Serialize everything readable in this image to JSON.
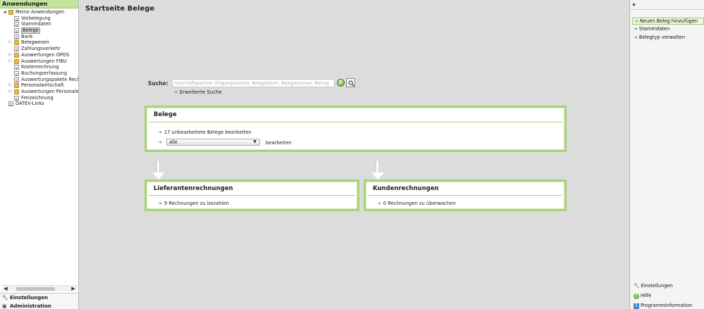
{
  "left_panel": {
    "header": "Anwendungen",
    "tree": [
      {
        "label": "Meine Anwendungen",
        "icon": "folder-icon",
        "expander": "expanded",
        "level": 0
      },
      {
        "label": "Vorbelegung",
        "icon": "page-icon",
        "expander": "",
        "level": 1
      },
      {
        "label": "Stammdaten",
        "icon": "page-icon",
        "expander": "",
        "level": 1
      },
      {
        "label": "Belege",
        "icon": "page-icon",
        "expander": "",
        "level": 1,
        "selected": true
      },
      {
        "label": "Bank",
        "icon": "page-icon",
        "expander": "",
        "level": 1
      },
      {
        "label": "Belegwesen",
        "icon": "folder-icon",
        "expander": "collapsed",
        "level": 1
      },
      {
        "label": "Zahlungsverkehr",
        "icon": "page-icon",
        "expander": "",
        "level": 1
      },
      {
        "label": "Auswertungen OPOS",
        "icon": "folder-icon",
        "expander": "collapsed",
        "level": 1
      },
      {
        "label": "Auswertungen FIBU",
        "icon": "folder-icon",
        "expander": "collapsed",
        "level": 1
      },
      {
        "label": "Kostenrechnung",
        "icon": "page-icon",
        "expander": "",
        "level": 1
      },
      {
        "label": "Buchungserfassung",
        "icon": "page-icon",
        "expander": "",
        "level": 1
      },
      {
        "label": "Auswertungspakete Rechnu",
        "icon": "page-icon",
        "expander": "",
        "level": 1
      },
      {
        "label": "Personalwirtschaft",
        "icon": "folder-icon",
        "expander": "collapsed",
        "level": 1
      },
      {
        "label": "Auswertungen Personalwir",
        "icon": "folder-icon",
        "expander": "collapsed",
        "level": 1
      },
      {
        "label": "Freizeichnung",
        "icon": "page-icon",
        "expander": "",
        "level": 1
      },
      {
        "label": "DATEV-Links",
        "icon": "page-icon",
        "expander": "",
        "level": 0
      }
    ],
    "footer": {
      "settings": "Einstellungen",
      "administration": "Administration"
    }
  },
  "main": {
    "title": "Startseite Belege",
    "search": {
      "label": "Suche:",
      "placeholder": "Geschäftspartner, Eingangsdatum, Belegdatum, Belegnummer, Betrag",
      "value": "",
      "advanced_link": "Erweiterte Suche"
    },
    "belege_panel": {
      "title": "Belege",
      "item_unprocessed": "17 unbearbeitete Belege bearbeiten",
      "select_value": "alle",
      "select_suffix": "bearbeiten"
    },
    "lieferanten_panel": {
      "title": "Lieferantenrechnungen",
      "item": "9 Rechnungen zu bezahlen"
    },
    "kunden_panel": {
      "title": "Kundenrechnungen",
      "item": "0 Rechnungen zu überwachen"
    }
  },
  "right_panel": {
    "tasks": [
      {
        "label": "Neuen Beleg hinzufügen",
        "highlighted": true
      },
      {
        "label": "Stammdaten",
        "highlighted": false
      },
      {
        "label": "Belegtyp verwalten",
        "highlighted": false
      }
    ],
    "footer": {
      "settings": "Einstellungen",
      "help": "Hilfe",
      "info": "Programminformation"
    }
  },
  "colors": {
    "accent_green": "#a9d27a",
    "header_green": "#c2e39b",
    "background": "#dcdcdc"
  }
}
